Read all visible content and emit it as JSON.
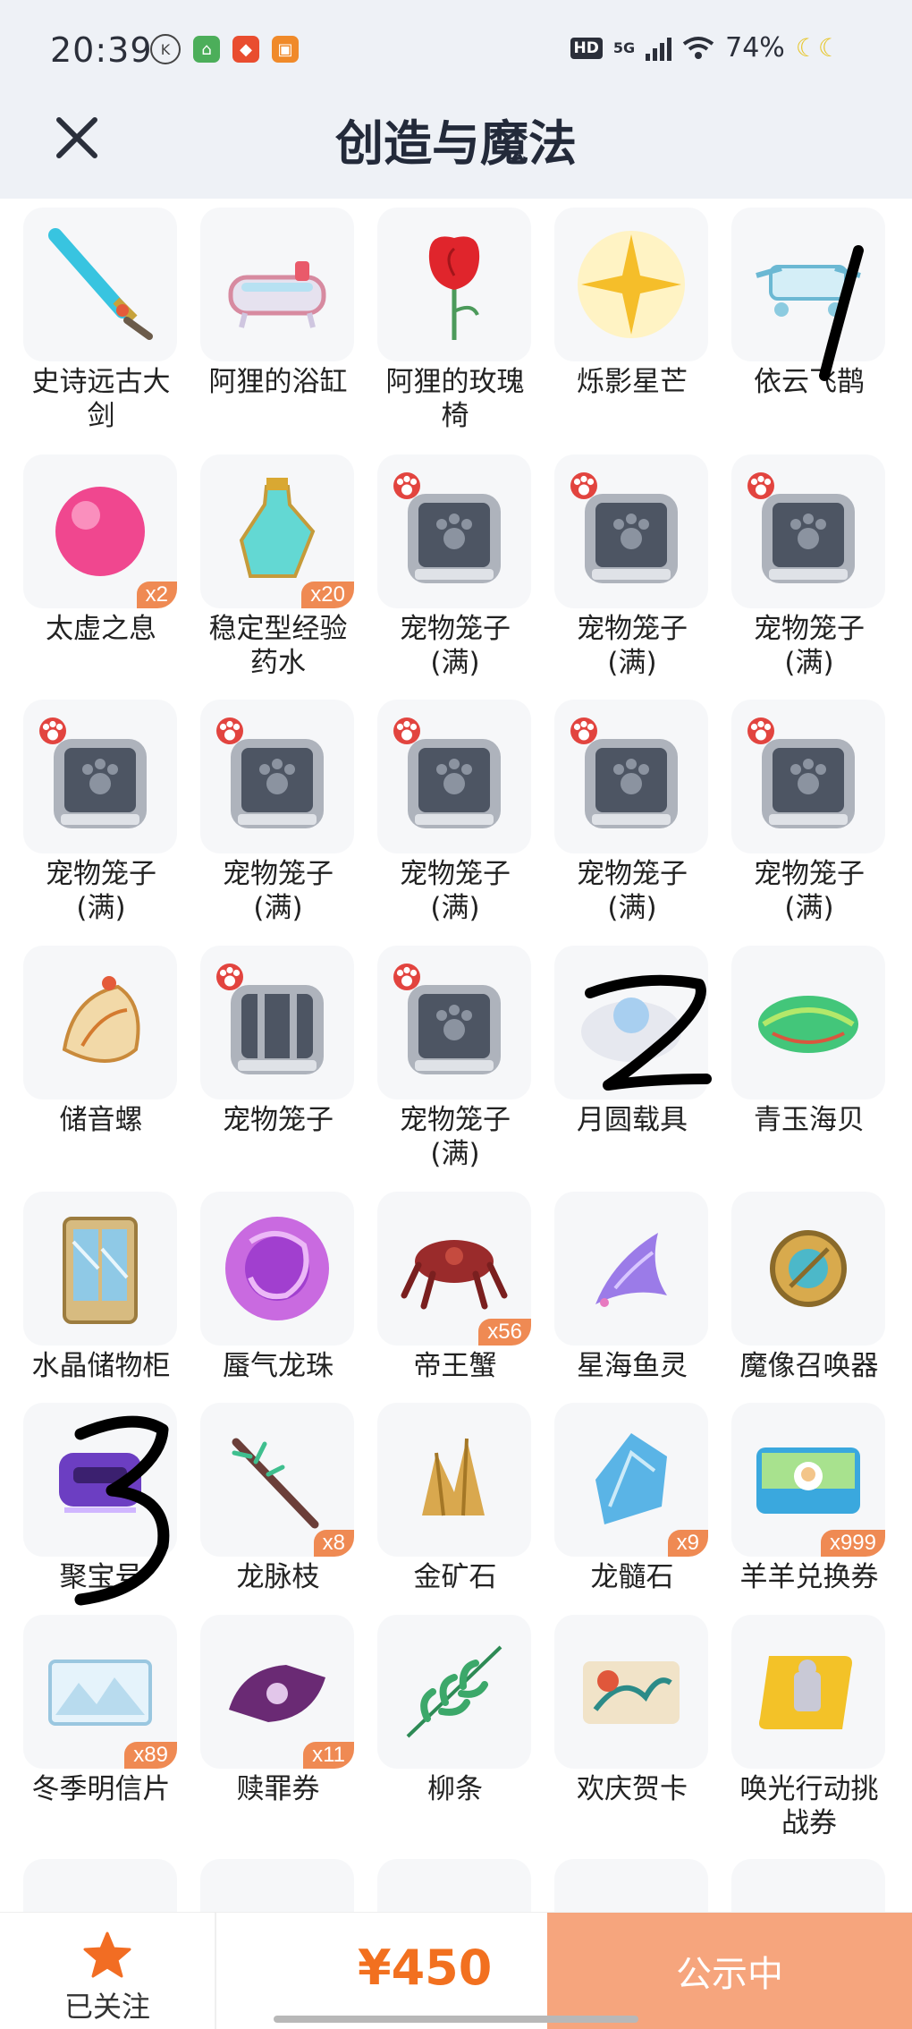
{
  "status_bar": {
    "time": "20:39",
    "battery": "74%",
    "hd": "HD",
    "network": "5G"
  },
  "header": {
    "title": "创造与魔法"
  },
  "items": [
    {
      "label": "史诗远古大剑",
      "icon": "sword-icon"
    },
    {
      "label": "阿狸的浴缸",
      "icon": "bathtub-icon"
    },
    {
      "label": "阿狸的玫瑰椅",
      "icon": "rose-chair-icon"
    },
    {
      "label": "烁影星芒",
      "icon": "star-icon"
    },
    {
      "label": "依云飞鹊",
      "icon": "flying-bird-icon"
    },
    {
      "label": "太虚之息",
      "icon": "pink-orb-icon",
      "badge": "x2"
    },
    {
      "label": "稳定型经验药水",
      "icon": "potion-icon",
      "badge": "x20"
    },
    {
      "label": "宠物笼子(满)",
      "icon": "pet-cage-icon"
    },
    {
      "label": "宠物笼子(满)",
      "icon": "pet-cage-icon"
    },
    {
      "label": "宠物笼子(满)",
      "icon": "pet-cage-icon"
    },
    {
      "label": "宠物笼子(满)",
      "icon": "pet-cage-icon"
    },
    {
      "label": "宠物笼子(满)",
      "icon": "pet-cage-icon"
    },
    {
      "label": "宠物笼子(满)",
      "icon": "pet-cage-icon"
    },
    {
      "label": "宠物笼子(满)",
      "icon": "pet-cage-icon"
    },
    {
      "label": "宠物笼子(满)",
      "icon": "pet-cage-icon"
    },
    {
      "label": "储音螺",
      "icon": "conch-icon"
    },
    {
      "label": "宠物笼子",
      "icon": "empty-cage-icon"
    },
    {
      "label": "宠物笼子(满)",
      "icon": "pet-cage-icon"
    },
    {
      "label": "月圆载具",
      "icon": "moon-vehicle-icon"
    },
    {
      "label": "青玉海贝",
      "icon": "jade-shell-icon"
    },
    {
      "label": "水晶储物柜",
      "icon": "crystal-cabinet-icon"
    },
    {
      "label": "蜃气龙珠",
      "icon": "dragon-orb-icon"
    },
    {
      "label": "帝王蟹",
      "icon": "king-crab-icon",
      "badge": "x56"
    },
    {
      "label": "星海鱼灵",
      "icon": "fish-spirit-icon"
    },
    {
      "label": "魔像召唤器",
      "icon": "golem-summoner-icon"
    },
    {
      "label": "聚宝号",
      "icon": "purple-ship-icon"
    },
    {
      "label": "龙脉枝",
      "icon": "dragon-branch-icon",
      "badge": "x8"
    },
    {
      "label": "金矿石",
      "icon": "gold-ore-icon"
    },
    {
      "label": "龙髓石",
      "icon": "dragon-stone-icon",
      "badge": "x9"
    },
    {
      "label": "羊羊兑换券",
      "icon": "sheep-coupon-icon",
      "badge": "x999"
    },
    {
      "label": "冬季明信片",
      "icon": "winter-postcard-icon",
      "badge": "x89"
    },
    {
      "label": "赎罪券",
      "icon": "redemption-coupon-icon",
      "badge": "x11"
    },
    {
      "label": "柳条",
      "icon": "willow-branch-icon"
    },
    {
      "label": "欢庆贺卡",
      "icon": "greeting-card-icon"
    },
    {
      "label": "唤光行动挑战券",
      "icon": "challenge-scroll-icon"
    }
  ],
  "bottom": {
    "follow_label": "已关注",
    "price": "¥450",
    "status_button": "公示中"
  },
  "colors": {
    "accent": "#f2701f",
    "button": "#f6a57d",
    "badge": "#ef8a53",
    "header_bg": "#eef1f6"
  }
}
